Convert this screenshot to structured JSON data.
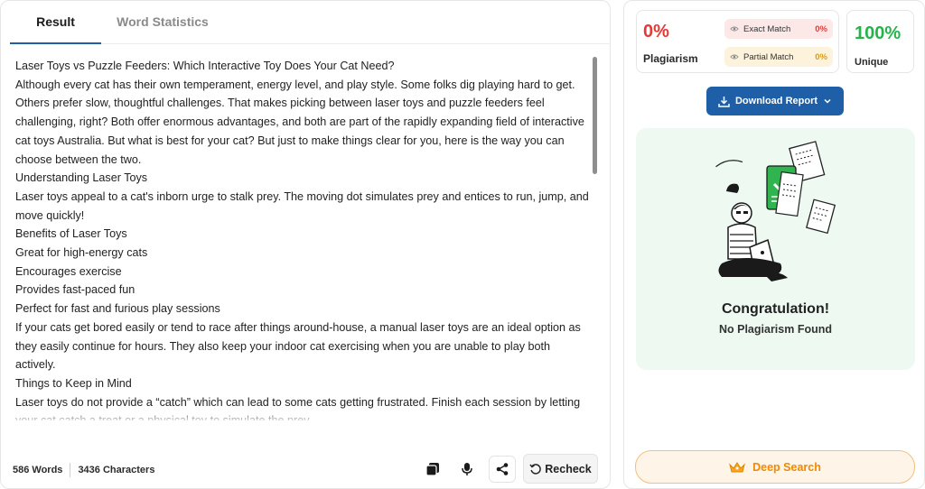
{
  "tabs": {
    "result": "Result",
    "word_statistics": "Word Statistics"
  },
  "content": {
    "lines": [
      "Laser Toys vs Puzzle Feeders: Which Interactive Toy Does Your Cat Need?",
      "Although every cat has their own temperament, energy level, and play style. Some folks dig playing hard to get. Others prefer slow, thoughtful challenges. That makes picking between laser toys and puzzle feeders feel challenging, right? Both offer enormous advantages, and both are part of the rapidly expanding field of interactive cat toys Australia. But what is best for your cat? But just to make things clear  for you, here is the way you can choose between the two.",
      "Understanding Laser Toys",
      "Laser toys appeal to a cat's inborn urge to stalk prey. The moving dot simulates prey and entices to run, jump, and move quickly!",
      "Benefits of Laser Toys",
      "Great for high-energy cats",
      "Encourages exercise",
      "Provides fast-paced fun",
      "Perfect for fast and furious play sessions",
      "If your cats get bored easily or tend to race after things around-house, a manual laser toys are an ideal option as they easily continue for hours. They also keep your indoor  cat exercising when you are unable to play both actively.",
      "Things to Keep in Mind",
      "Laser toys do not  provide a “catch” which can lead to some cats getting frustrated. Finish each session by letting your cat catch a treat or a physical toy to simulate the prey."
    ]
  },
  "footer": {
    "words": "586 Words",
    "characters": "3436 Characters",
    "recheck": "Recheck"
  },
  "stats": {
    "plagiarism_pct": "0%",
    "plagiarism_label": "Plagiarism",
    "exact_match_label": "Exact Match",
    "exact_match_val": "0%",
    "partial_match_label": "Partial Match",
    "partial_match_val": "0%",
    "unique_pct": "100%",
    "unique_label": "Unique"
  },
  "download": {
    "label": "Download Report"
  },
  "result": {
    "title": "Congratulation!",
    "subtitle": "No Plagiarism Found"
  },
  "deep_search": {
    "label": "Deep Search"
  },
  "colors": {
    "primary": "#1f5fa8",
    "danger": "#e53935",
    "success": "#25b34b",
    "warning": "#f08a00",
    "card_bg": "#eefaf1"
  },
  "icons": [
    "copy-icon",
    "microphone-icon",
    "share-icon",
    "refresh-icon",
    "eye-icon",
    "download-icon",
    "chevron-down-icon",
    "crown-icon"
  ]
}
